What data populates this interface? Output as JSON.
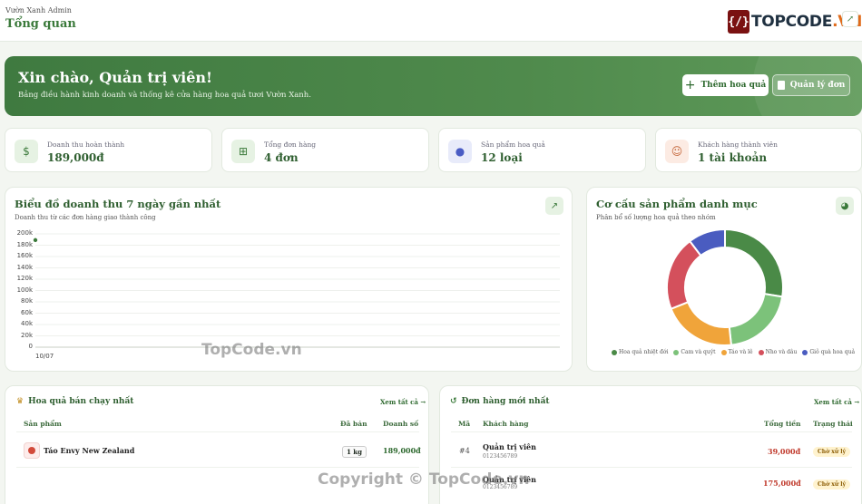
{
  "header": {
    "brand_sub": "Vườn Xanh Admin",
    "title": "Tổng quan",
    "logo_mark": "{/}",
    "logo_text": "TOPCODE",
    "logo_suffix": ".VN"
  },
  "hero": {
    "title": "Xin chào, Quản trị viên!",
    "subtitle": "Bảng điều hành kinh doanh và thống kê cửa hàng hoa quả tươi Vườn Xanh.",
    "add_button": "Thêm hoa quả",
    "manage_button": "Quản lý đơn"
  },
  "stats": [
    {
      "label": "Doanh thu hoàn thành",
      "value": "189,000đ",
      "icon": "money-bag-icon",
      "icon_bg": "#e6f2e3",
      "icon_color": "#3b7a3b",
      "glyph": "$"
    },
    {
      "label": "Tổng đơn hàng",
      "value": "4 đơn",
      "icon": "cart-icon",
      "icon_bg": "#e6f2e3",
      "icon_color": "#3b7a3b",
      "glyph": "⊞"
    },
    {
      "label": "Sản phẩm hoa quả",
      "value": "12 loại",
      "icon": "apple-icon",
      "icon_bg": "#e8ebfa",
      "icon_color": "#4a5cc4",
      "glyph": "●"
    },
    {
      "label": "Khách hàng thành viên",
      "value": "1 tài khoản",
      "icon": "user-card-icon",
      "icon_bg": "#fcebe3",
      "icon_color": "#c4663a",
      "glyph": "☺"
    }
  ],
  "revenue_chart": {
    "title": "Biểu đồ doanh thu 7 ngày gần nhất",
    "subtitle": "Doanh thu từ các đơn hàng giao thành công"
  },
  "category_chart": {
    "title": "Cơ cấu sản phẩm danh mục",
    "subtitle": "Phân bổ số lượng hoa quả theo nhóm"
  },
  "chart_data": [
    {
      "type": "line",
      "x": [
        "10/07"
      ],
      "series": [
        {
          "values": [
            189000
          ]
        }
      ],
      "ylim": [
        0,
        200000
      ],
      "yticks": [
        "0",
        "20k",
        "40k",
        "60k",
        "80k",
        "100k",
        "120k",
        "140k",
        "160k",
        "180k",
        "200k"
      ],
      "color": "#3b7a3b",
      "grid": true
    },
    {
      "type": "pie",
      "donut": true,
      "categories": [
        "Hoa quả nhiệt đới",
        "Cam và quýt",
        "Táo và lê",
        "Nho và dâu",
        "Giỏ quà hoa quả"
      ],
      "values": [
        4,
        3,
        3,
        3,
        1.5
      ],
      "colors": [
        "#4a8a47",
        "#7cc27a",
        "#f0a43a",
        "#d4505c",
        "#4a5cc0"
      ],
      "legend": "bottom"
    }
  ],
  "bestsellers": {
    "title": "Hoa quả bán chạy nhất",
    "see_all": "Xem tất cả →",
    "columns": [
      "Sản phẩm",
      "Đã bán",
      "Doanh số"
    ],
    "rows": [
      {
        "name": "Táo Envy New Zealand",
        "qty": "1 kg",
        "revenue": "189,000đ"
      }
    ]
  },
  "recent_orders": {
    "title": "Đơn hàng mới nhất",
    "see_all": "Xem tất cả →",
    "columns": [
      "Mã",
      "Khách hàng",
      "Tổng tiền",
      "Trạng thái"
    ],
    "rows": [
      {
        "id": "#4",
        "customer": "Quản trị viên",
        "phone": "0123456789",
        "total": "39,000đ",
        "status": "Chờ xử lý"
      },
      {
        "id": "",
        "customer": "Quản trị viên",
        "phone": "0123456789",
        "total": "175,000đ",
        "status": "Chờ xử lý"
      }
    ]
  },
  "watermarks": {
    "center": "TopCode.vn",
    "bottom": "Copyright © TopCode.vn"
  }
}
